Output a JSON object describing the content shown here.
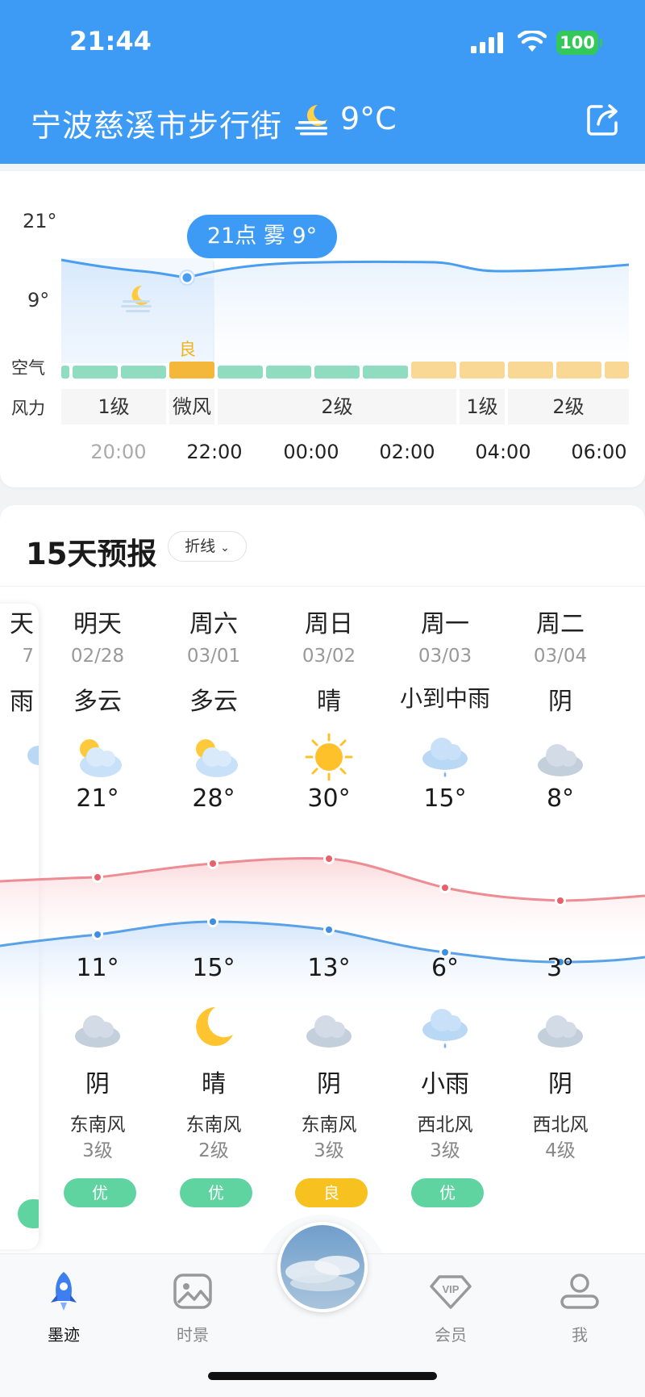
{
  "status": {
    "time": "21:44",
    "battery": "100"
  },
  "header": {
    "location": "宁波慈溪市步行街",
    "temp": "9°C",
    "share_icon": "share-icon"
  },
  "hourly": {
    "y_max": "21°",
    "y_mid": "9°",
    "tooltip": "21点 雾 9°",
    "aq_row_label": "空气",
    "aq_current": "良",
    "wind_row_label": "风力",
    "wind": [
      "1级",
      "微风",
      "2级",
      "1级",
      "2级"
    ],
    "hours": [
      "20:00",
      "22:00",
      "00:00",
      "02:00",
      "04:00",
      "06:00"
    ],
    "colors": {
      "aq_good": "#8fdcc1",
      "aq_fair": "#f8d894",
      "aq_current": "#f5b73a",
      "line": "#4a9ef0"
    }
  },
  "daily": {
    "title": "15天预报",
    "chart_type": "折线",
    "today_partial": {
      "name": "天",
      "date": "7",
      "weather": "雨"
    },
    "days": [
      {
        "name": "明天",
        "date": "02/28",
        "day_weather": "多云",
        "day_icon": "partly-cloudy-icon",
        "high": "21°",
        "low": "11°",
        "night_icon": "cloud-icon",
        "night_weather": "阴",
        "wind_dir": "东南风",
        "wind_level": "3级",
        "aq": "优"
      },
      {
        "name": "周六",
        "date": "03/01",
        "day_weather": "多云",
        "day_icon": "partly-cloudy-icon",
        "high": "28°",
        "low": "15°",
        "night_icon": "moon-icon",
        "night_weather": "晴",
        "wind_dir": "东南风",
        "wind_level": "2级",
        "aq": "优"
      },
      {
        "name": "周日",
        "date": "03/02",
        "day_weather": "晴",
        "day_icon": "sun-icon",
        "high": "30°",
        "low": "13°",
        "night_icon": "cloud-icon",
        "night_weather": "阴",
        "wind_dir": "东南风",
        "wind_level": "3级",
        "aq": "良"
      },
      {
        "name": "周一",
        "date": "03/03",
        "day_weather": "小到中雨",
        "day_icon": "rain-cloud-icon",
        "high": "15°",
        "low": "6°",
        "night_icon": "rain-cloud-icon",
        "night_weather": "小雨",
        "wind_dir": "西北风",
        "wind_level": "3级",
        "aq": "优"
      },
      {
        "name": "周二",
        "date": "03/04",
        "day_weather": "阴",
        "day_icon": "cloud-icon",
        "high": "8°",
        "low": "3°",
        "night_icon": "cloud-icon",
        "night_weather": "阴",
        "wind_dir": "西北风",
        "wind_level": "4级",
        "aq": ""
      }
    ],
    "colors": {
      "high_line": "#ee8c93",
      "low_line": "#5aa2e8",
      "aq_excellent": "#5fd3a0",
      "aq_good": "#f7c11f"
    }
  },
  "tabbar": {
    "tabs": [
      {
        "label": "墨迹",
        "icon": "rocket-icon",
        "active": true
      },
      {
        "label": "时景",
        "icon": "photo-icon",
        "active": false
      },
      {
        "label": "会员",
        "icon": "vip-icon",
        "active": false
      },
      {
        "label": "我",
        "icon": "profile-icon",
        "active": false
      }
    ]
  }
}
